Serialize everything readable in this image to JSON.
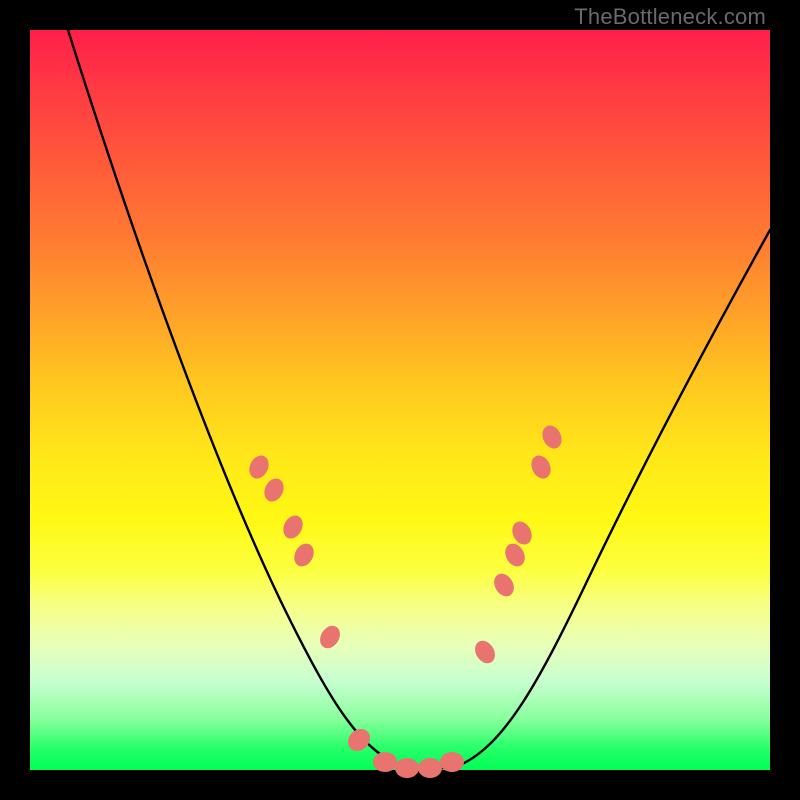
{
  "watermark": "TheBottleneck.com",
  "chart_data": {
    "type": "line",
    "title": "",
    "xlabel": "",
    "ylabel": "",
    "x": [
      0.05,
      0.1,
      0.15,
      0.2,
      0.25,
      0.3,
      0.35,
      0.4,
      0.45,
      0.5,
      0.55,
      0.6,
      0.65,
      0.7,
      0.75,
      0.8,
      0.85,
      0.9,
      0.95,
      1.0
    ],
    "values": [
      100,
      90,
      80,
      68,
      55,
      42,
      28,
      15,
      6,
      1,
      0,
      1,
      6,
      15,
      26,
      37,
      48,
      58,
      67,
      75
    ],
    "xlim": [
      0,
      1
    ],
    "ylim": [
      0,
      100
    ],
    "highlight_x": [
      0.31,
      0.33,
      0.355,
      0.37,
      0.405,
      0.445,
      0.48,
      0.51,
      0.54,
      0.57,
      0.615,
      0.64,
      0.655,
      0.665,
      0.69,
      0.705
    ],
    "highlight_y": [
      41,
      38,
      33,
      29,
      18,
      4,
      1,
      0,
      0,
      1,
      16,
      25,
      29,
      32,
      41,
      45
    ],
    "gradient_stops": [
      "#ff1f4a",
      "#ff7a32",
      "#ffe819",
      "#00ff55"
    ],
    "legend": []
  }
}
